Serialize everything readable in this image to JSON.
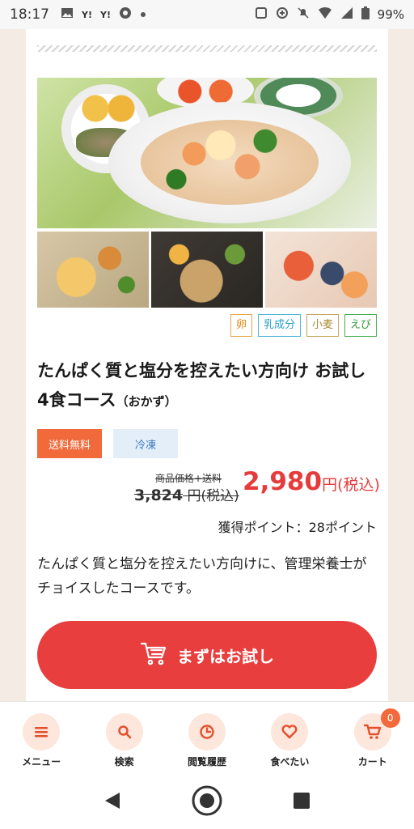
{
  "status_bar": {
    "time": "18:17",
    "left_icons": [
      "image-icon",
      "yahoo-icon",
      "yahoo-icon",
      "chrome-icon",
      "dot-icon"
    ],
    "yahoo_label": "Y!",
    "battery": "99%",
    "right_icons": [
      "nfc-icon",
      "data-saver-icon",
      "mute-icon",
      "wifi-icon",
      "signal-icon",
      "battery-icon"
    ]
  },
  "product": {
    "image_alt": "",
    "allergens": [
      "卵",
      "乳成分",
      "小麦",
      "えび"
    ],
    "title_main": "たんぱく質と塩分を控えたい方向け お試し4食コース",
    "title_sub": "（おかず）",
    "tags": [
      "送料無料",
      "冷凍"
    ],
    "original_label": "商品価格+送料",
    "original_price": "3,824",
    "original_unit": "円(税込)",
    "price": "2,980",
    "price_unit": "円(税込)",
    "points": "獲得ポイント：28ポイント",
    "description": "たんぱく質と塩分を控えたい方向けに、管理栄養士がチョイスしたコースです。",
    "cta_label": "まずはお試し"
  },
  "bottom_nav": {
    "items": [
      {
        "label": "メニュー",
        "icon": "menu-icon"
      },
      {
        "label": "検索",
        "icon": "search-icon"
      },
      {
        "label": "閲覧履歴",
        "icon": "clock-icon"
      },
      {
        "label": "食べたい",
        "icon": "heart-icon"
      },
      {
        "label": "カート",
        "icon": "cart-icon"
      }
    ],
    "cart_count": "0"
  },
  "colors": {
    "accent": "#e83e3e",
    "nav_icon": "#e4502a",
    "tag_free_bg": "#f26a3c",
    "tag_frozen_bg": "#e4eef9"
  }
}
